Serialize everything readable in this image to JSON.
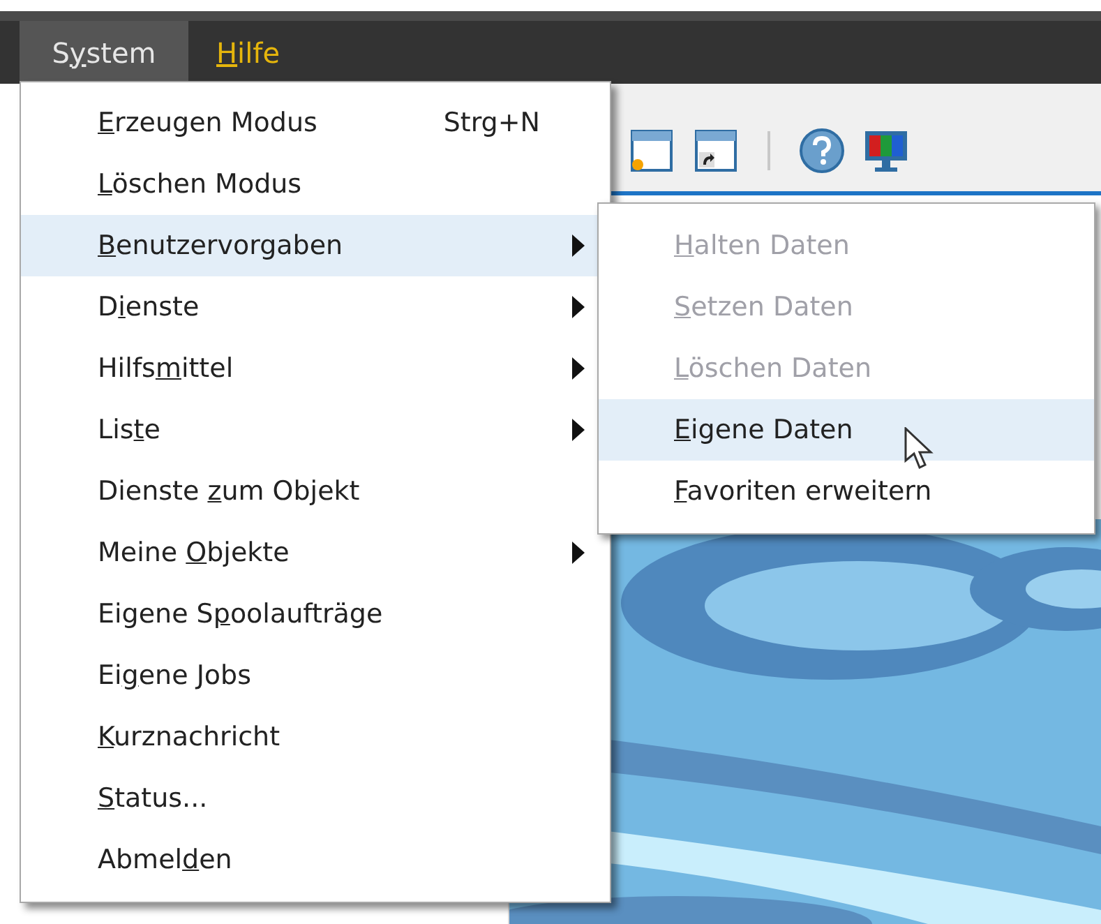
{
  "menubar": [
    {
      "pre": "S",
      "key": "y",
      "post": "stem",
      "selected": true
    },
    {
      "key": "H",
      "post": "ilfe",
      "selected": false
    }
  ],
  "menu": [
    {
      "key": "E",
      "post": "rzeugen Modus",
      "shortcut": "Strg+N",
      "submenu": false,
      "selected": false
    },
    {
      "key": "L",
      "post": "öschen Modus",
      "submenu": false,
      "selected": false
    },
    {
      "key": "B",
      "post": "enutzervorgaben",
      "submenu": true,
      "selected": true
    },
    {
      "pre": "D",
      "key": "i",
      "post": "enste",
      "submenu": true,
      "selected": false
    },
    {
      "pre": "Hilfs",
      "key": "m",
      "post": "ittel",
      "submenu": true,
      "selected": false
    },
    {
      "pre": "Lis",
      "key": "t",
      "post": "e",
      "submenu": true,
      "selected": false
    },
    {
      "pre": "Dienste ",
      "key": "z",
      "post": "um Objekt",
      "submenu": false,
      "selected": false
    },
    {
      "pre": "Meine ",
      "key": "O",
      "post": "bjekte",
      "submenu": true,
      "selected": false
    },
    {
      "pre": "Eigene S",
      "key": "p",
      "post": "oolaufträge",
      "submenu": false,
      "selected": false
    },
    {
      "pre": "Ei",
      "key": "g",
      "post": "ene Jobs",
      "submenu": false,
      "selected": false
    },
    {
      "key": "K",
      "post": "urznachricht",
      "submenu": false,
      "selected": false
    },
    {
      "key": "S",
      "post": "tatus...",
      "submenu": false,
      "selected": false
    },
    {
      "pre": "Abmel",
      "key": "d",
      "post": "en",
      "submenu": false,
      "selected": false
    }
  ],
  "submenu": [
    {
      "key": "H",
      "post": "alten Daten",
      "disabled": true,
      "selected": false
    },
    {
      "key": "S",
      "post": "etzen Daten",
      "disabled": true,
      "selected": false
    },
    {
      "key": "L",
      "post": "öschen Daten",
      "disabled": true,
      "selected": false
    },
    {
      "key": "E",
      "post": "igene Daten",
      "disabled": false,
      "selected": true
    },
    {
      "key": "F",
      "post": "avoriten erweitern",
      "disabled": false,
      "selected": false
    }
  ]
}
